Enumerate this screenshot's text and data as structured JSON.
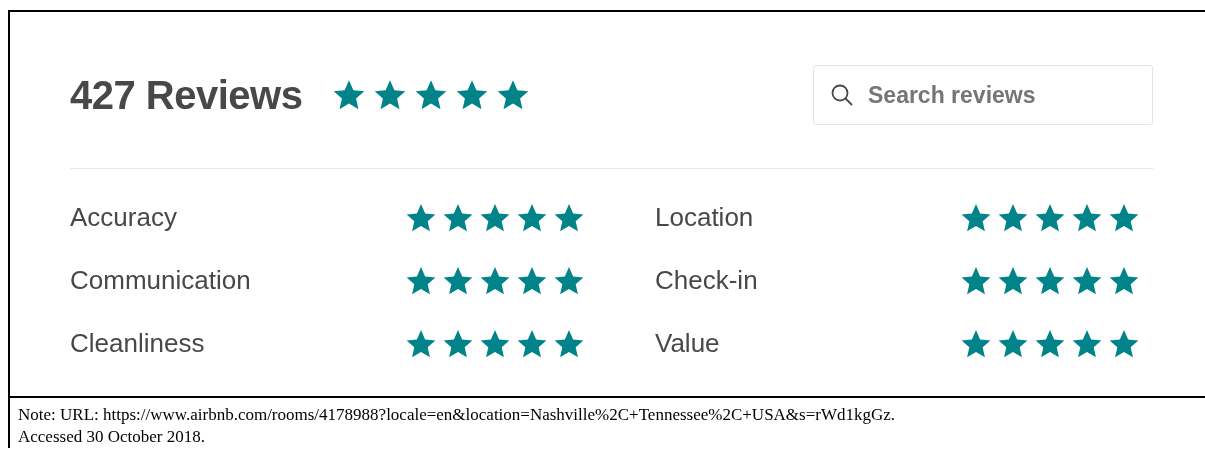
{
  "header": {
    "title": "427 Reviews",
    "stars": 5
  },
  "search": {
    "placeholder": "Search reviews"
  },
  "ratings": [
    {
      "label": "Accuracy",
      "stars": 5
    },
    {
      "label": "Location",
      "stars": 5
    },
    {
      "label": "Communication",
      "stars": 5
    },
    {
      "label": "Check-in",
      "stars": 5
    },
    {
      "label": "Cleanliness",
      "stars": 5
    },
    {
      "label": "Value",
      "stars": 5
    }
  ],
  "note": {
    "lines": [
      "Note: URL: https://www.airbnb.com/rooms/4178988?locale=en&location=Nashville%2C+Tennessee%2C+USA&s=rWd1kgGz.",
      "Accessed 30 October 2018."
    ]
  }
}
